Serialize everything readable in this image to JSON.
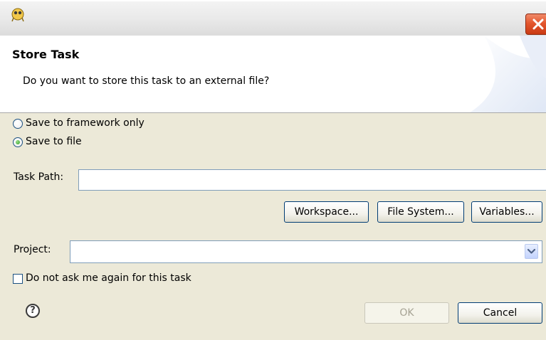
{
  "window": {
    "close_label": "×"
  },
  "header": {
    "title": "Store Task",
    "message": "Do you want to store this task to an external file?"
  },
  "options": {
    "framework_only_label": "Save to framework only",
    "save_to_file_label": "Save to file",
    "selected": "save_to_file"
  },
  "task_path": {
    "label": "Task Path:",
    "value": "",
    "placeholder": ""
  },
  "browse_buttons": {
    "workspace": "Workspace...",
    "file_system": "File System...",
    "variables": "Variables..."
  },
  "project": {
    "label": "Project:",
    "value": ""
  },
  "do_not_ask": {
    "label": "Do not ask me again for this task",
    "checked": false
  },
  "footer": {
    "help_glyph": "?",
    "ok_label": "OK",
    "cancel_label": "Cancel",
    "ok_enabled": false
  },
  "colors": {
    "dialog_body": "#ece9d8",
    "button_border": "#003c74",
    "close_red": "#e4572e"
  }
}
